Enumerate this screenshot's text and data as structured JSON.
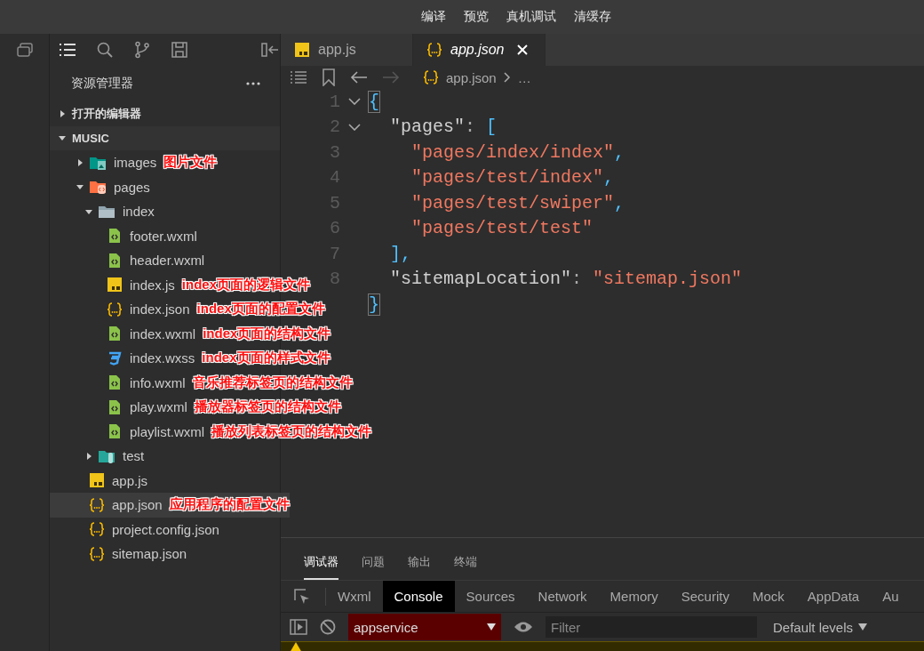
{
  "toolbar": {
    "buttons": [
      "编译",
      "预览",
      "真机调试",
      "清缓存"
    ]
  },
  "sidebar": {
    "title": "资源管理器",
    "sections": [
      {
        "label": "打开的编辑器",
        "expanded": false
      },
      {
        "label": "MUSIC",
        "expanded": true
      }
    ],
    "tree": [
      {
        "name": "images",
        "kind": "folder-images",
        "expanded": false,
        "selected": false,
        "note": "图片文件"
      },
      {
        "name": "pages",
        "kind": "folder-pages",
        "expanded": true,
        "selected": false,
        "children": [
          {
            "name": "index",
            "kind": "folder",
            "expanded": true,
            "selected": false,
            "children": [
              {
                "name": "footer.wxml",
                "kind": "wxml",
                "selected": false
              },
              {
                "name": "header.wxml",
                "kind": "wxml",
                "selected": false
              },
              {
                "name": "index.js",
                "kind": "js",
                "selected": false,
                "note": "index页面的逻辑文件"
              },
              {
                "name": "index.json",
                "kind": "json",
                "selected": false,
                "note": "index页面的配置文件"
              },
              {
                "name": "index.wxml",
                "kind": "wxml",
                "selected": false,
                "note": "index页面的结构文件"
              },
              {
                "name": "index.wxss",
                "kind": "wxss",
                "selected": false,
                "note": "index页面的样式文件"
              },
              {
                "name": "info.wxml",
                "kind": "wxml",
                "selected": false,
                "note": "音乐推荐标签页的结构文件"
              },
              {
                "name": "play.wxml",
                "kind": "wxml",
                "selected": false,
                "note": "播放器标签页的结构文件"
              },
              {
                "name": "playlist.wxml",
                "kind": "wxml",
                "selected": false,
                "note": "播放列表标签页的结构文件"
              }
            ]
          },
          {
            "name": "test",
            "kind": "folder-test",
            "expanded": false,
            "selected": false
          }
        ]
      },
      {
        "name": "app.js",
        "kind": "js",
        "selected": false
      },
      {
        "name": "app.json",
        "kind": "json",
        "selected": true,
        "note": "应用程序的配置文件"
      },
      {
        "name": "project.config.json",
        "kind": "json",
        "selected": false
      },
      {
        "name": "sitemap.json",
        "kind": "json",
        "selected": false
      }
    ]
  },
  "editor": {
    "tabs": [
      {
        "label": "app.js",
        "kind": "js",
        "selected": false
      },
      {
        "label": "app.json",
        "kind": "json",
        "selected": true
      }
    ],
    "breadcrumb": {
      "file": "app.json",
      "rest": "…"
    },
    "lines": [
      {
        "number": "1",
        "fold": true,
        "tokens": [
          {
            "t": "{",
            "kind": "brace"
          }
        ]
      },
      {
        "number": "2",
        "fold": true,
        "tokens": [
          {
            "t": "  \"pages\"",
            "kind": "key"
          },
          {
            "t": ": ",
            "kind": "punct"
          },
          {
            "t": "[",
            "kind": "bracket"
          }
        ]
      },
      {
        "number": "3",
        "fold": false,
        "tokens": [
          {
            "t": "    \"pages/index/index\"",
            "kind": "string"
          },
          {
            "t": ",",
            "kind": "bracket"
          }
        ]
      },
      {
        "number": "4",
        "fold": false,
        "tokens": [
          {
            "t": "    \"pages/test/index\"",
            "kind": "string"
          },
          {
            "t": ",",
            "kind": "bracket"
          }
        ]
      },
      {
        "number": "5",
        "fold": false,
        "tokens": [
          {
            "t": "    \"pages/test/swiper\"",
            "kind": "string"
          },
          {
            "t": ",",
            "kind": "bracket"
          }
        ]
      },
      {
        "number": "6",
        "fold": false,
        "tokens": [
          {
            "t": "    \"pages/test/test\"",
            "kind": "string"
          }
        ]
      },
      {
        "number": "7",
        "fold": false,
        "tokens": [
          {
            "t": "  ],",
            "kind": "bracket"
          }
        ]
      },
      {
        "number": "8",
        "fold": false,
        "tokens": [
          {
            "t": "  \"sitemapLocation\"",
            "kind": "key"
          },
          {
            "t": ": ",
            "kind": "punct"
          },
          {
            "t": "\"sitemap.json\"",
            "kind": "string"
          }
        ]
      },
      {
        "fold": false,
        "tokens": [
          {
            "t": "}",
            "kind": "brace"
          }
        ]
      }
    ]
  },
  "panel": {
    "tabs": [
      {
        "label": "调试器",
        "selected": true
      },
      {
        "label": "问题",
        "selected": false
      },
      {
        "label": "输出",
        "selected": false
      },
      {
        "label": "终端",
        "selected": false
      }
    ],
    "devtools_tabs": [
      {
        "label": "Wxml",
        "selected": false
      },
      {
        "label": "Console",
        "selected": true
      },
      {
        "label": "Sources",
        "selected": false
      },
      {
        "label": "Network",
        "selected": false
      },
      {
        "label": "Memory",
        "selected": false
      },
      {
        "label": "Security",
        "selected": false
      },
      {
        "label": "Mock",
        "selected": false
      },
      {
        "label": "AppData",
        "selected": false
      },
      {
        "label": "Au",
        "selected": false
      }
    ],
    "context": "appservice",
    "filter": {
      "placeholder": "Filter"
    },
    "levels": "Default levels"
  }
}
